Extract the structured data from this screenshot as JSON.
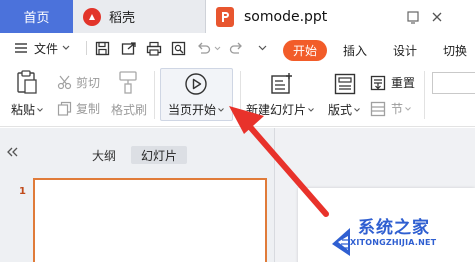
{
  "titlebar": {
    "home_tab": "首页",
    "daoke_tab": "稻壳",
    "doc_tab": "somode.ppt"
  },
  "menu": {
    "file": "文件",
    "start": "开始",
    "insert": "插入",
    "design": "设计",
    "transition": "切换"
  },
  "ribbon": {
    "paste": "粘贴",
    "cut": "剪切",
    "copy": "复制",
    "format_painter": "格式刷",
    "play_from_current": "当页开始",
    "new_slide": "新建幻灯片",
    "layout": "版式",
    "section": "节",
    "reset": "重置"
  },
  "panel": {
    "outline": "大纲",
    "slides": "幻灯片",
    "slide_number": "1"
  },
  "watermark": {
    "name": "系统之家",
    "url": "XITONGZHIJIA.NET"
  },
  "colors": {
    "accent": "#f25c29",
    "home_tab": "#4b72db",
    "arrow": "#e8322b"
  }
}
